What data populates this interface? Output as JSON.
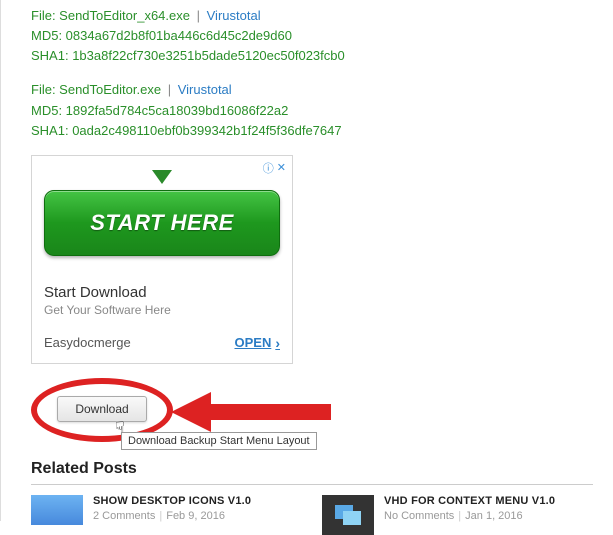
{
  "files": [
    {
      "file_prefix": "File: ",
      "filename": "SendToEditor_x64.exe",
      "virustotal_label": "Virustotal",
      "md5_prefix": "MD5: ",
      "md5": "0834a67d2b8f01ba446c6d45c2de9d60",
      "sha1_prefix": "SHA1: ",
      "sha1": "1b3a8f22cf730e3251b5dade5120ec50f023fcb0"
    },
    {
      "file_prefix": "File: ",
      "filename": "SendToEditor.exe",
      "virustotal_label": "Virustotal",
      "md5_prefix": "MD5: ",
      "md5": "1892fa5d784c5ca18039bd16086f22a2",
      "sha1_prefix": "SHA1: ",
      "sha1": "0ada2c498110ebf0b399342b1f24f5f36dfe7647"
    }
  ],
  "ad": {
    "info_icon": "ⓘ",
    "close_icon": "✕",
    "start_label": "START HERE",
    "title": "Start Download",
    "subtitle": "Get Your Software Here",
    "brand": "Easydocmerge",
    "open_label": "OPEN"
  },
  "download": {
    "button_label": "Download",
    "tooltip": "Download Backup Start Menu Layout"
  },
  "related": {
    "heading": "Related Posts",
    "posts": [
      {
        "title": "SHOW DESKTOP ICONS V1.0",
        "comments": "2 Comments",
        "date": "Feb 9, 2016"
      },
      {
        "title": "VHD FOR CONTEXT MENU V1.0",
        "comments": "No Comments",
        "date": "Jan 1, 2016"
      }
    ]
  }
}
